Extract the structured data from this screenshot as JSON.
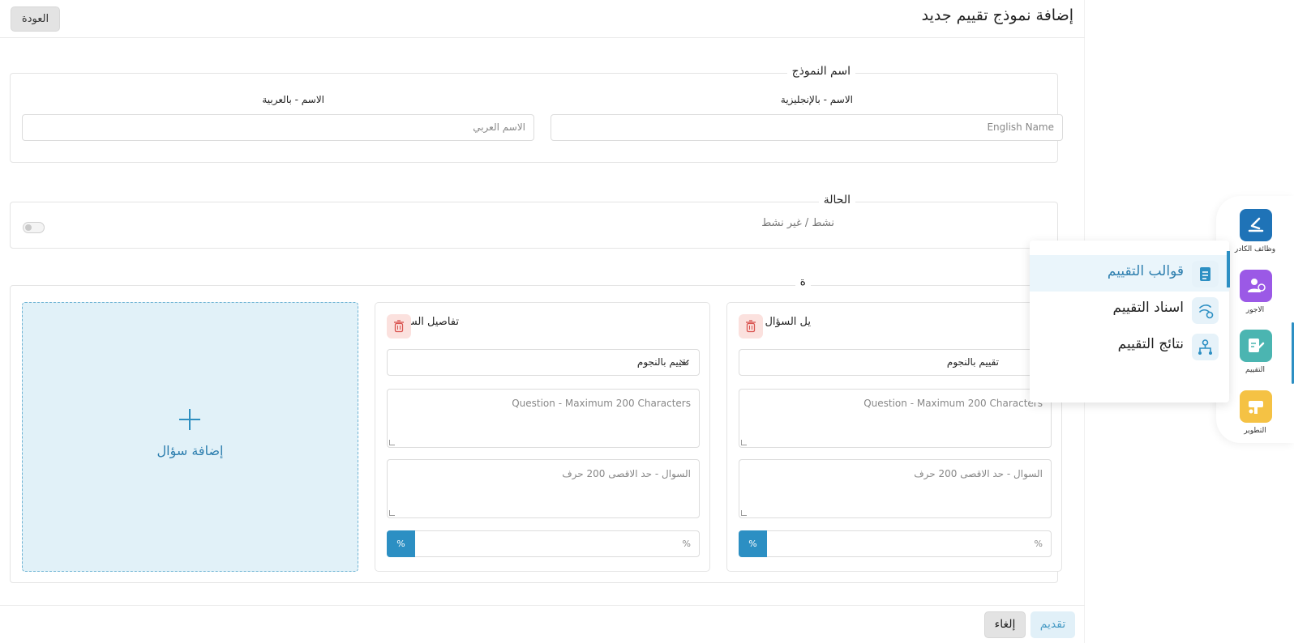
{
  "header": {
    "title": "إضافة نموذج تقييم جديد",
    "back_label": "العودة"
  },
  "form_name": {
    "legend": "اسم النموذج",
    "english_label": "الاسم - بالإنجليزية",
    "english_placeholder": "English Name",
    "arabic_label": "الاسم - بالعربية",
    "arabic_placeholder": "الاسم العربي"
  },
  "status": {
    "legend": "الحالة",
    "toggle_label": "نشط / غير نشط",
    "active": false
  },
  "questions": {
    "legend_fragment": "ة",
    "add_label": "إضافة سؤال",
    "cards": [
      {
        "title": "يل السؤال",
        "type_value": "تقييم بالنجوم",
        "question_en_placeholder": "Question - Maximum 200 Characters",
        "question_ar_placeholder": "السوال - حد الاقصى 200 حرف",
        "percent_placeholder": "%",
        "percent_button": "%"
      },
      {
        "title": "تفاصيل السؤال",
        "type_value": "تقييم بالنجوم",
        "question_en_placeholder": "Question - Maximum 200 Characters",
        "question_ar_placeholder": "السوال - حد الاقصى 200 حرف",
        "percent_placeholder": "%",
        "percent_button": "%"
      }
    ]
  },
  "footer": {
    "submit_label": "تقديم",
    "cancel_label": "إلغاء"
  },
  "sidebar": {
    "items": [
      {
        "label": "وظائف الكادر",
        "icon": "staff-jobs-icon",
        "color": "#1f73b7"
      },
      {
        "label": "الاجور",
        "icon": "wages-icon",
        "color": "#9b59e6"
      },
      {
        "label": "التقييم",
        "icon": "evaluation-icon",
        "color": "#4bb5b1",
        "active": true
      },
      {
        "label": "التطوير",
        "icon": "development-icon",
        "color": "#f5c244"
      }
    ]
  },
  "submenu": {
    "items": [
      {
        "label": "قوالب التقييم",
        "icon": "templates-icon",
        "active": true
      },
      {
        "label": "اسناد التقييم",
        "icon": "assign-icon"
      },
      {
        "label": "نتائج التقييم",
        "icon": "results-icon"
      }
    ]
  },
  "colors": {
    "primary": "#2c8fc3",
    "add_card_bg": "#e1f1f8",
    "trash_bg": "#fbe1de"
  }
}
